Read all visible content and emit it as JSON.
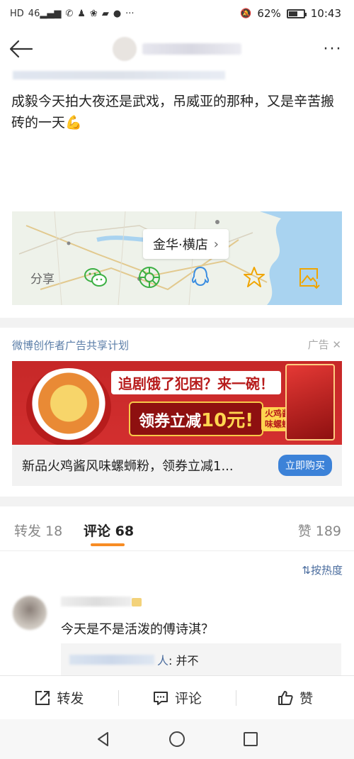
{
  "status_bar": {
    "battery_pct": "62%",
    "battery_level": 0.62,
    "time": "10:43",
    "signal": "46"
  },
  "post": {
    "text": "成毅今天拍大夜还是武戏，吊威亚的那种，又是辛苦搬砖的一天",
    "emoji": "💪",
    "location_label": "金华·横店",
    "share_label": "分享",
    "share_icons": [
      "wechat-icon",
      "moments-icon",
      "qq-icon",
      "favorite-star-icon",
      "save-image-icon"
    ]
  },
  "ad": {
    "title": "微博创作者广告共享计划",
    "tag": "广告",
    "slogan": "追剧饿了犯困？来一碗！",
    "coupon_prefix": "领券立减",
    "coupon_amount": "10元!",
    "badge": "火鸡酱风味螺蛳粉",
    "description": "新品火鸡酱风味螺蛳粉，领券立减1...",
    "buy_button": "立即购买"
  },
  "tabs": {
    "repost": "转发 18",
    "comment": "评论 68",
    "like": "赞 189"
  },
  "comments": {
    "sort_label": "按热度",
    "items": [
      {
        "text": "今天是不是活泼的傅诗淇？",
        "reply_suffix": "人",
        "reply_text": ": 并不"
      }
    ]
  },
  "action_bar": {
    "repost": "转发",
    "comment": "评论",
    "like": "赞"
  },
  "colors": {
    "link_blue": "#5b7ea8",
    "accent_orange": "#f78c24",
    "buy_blue": "#3c82d8"
  }
}
